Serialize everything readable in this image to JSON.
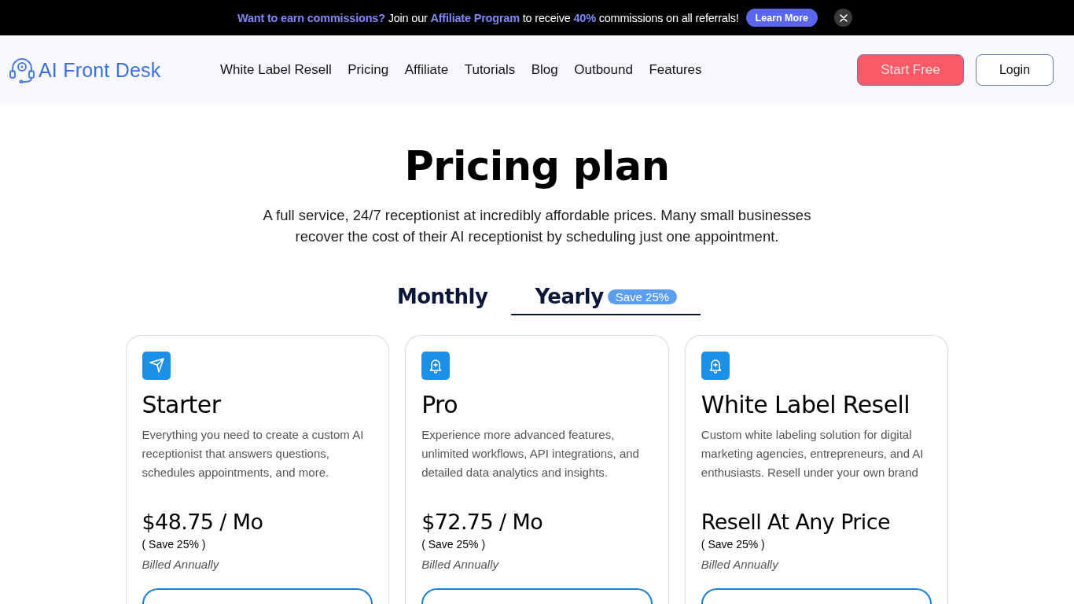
{
  "banner": {
    "message": "**Want to earn commissions?** Join our **Affiliate Program** to receive **40%** commissions on all referrals!",
    "button": "Learn More"
  },
  "header": {
    "logo": "AI Front Desk",
    "nav": [
      "White Label Resell",
      "Pricing",
      "Affiliate",
      "Tutorials",
      "Blog",
      "Outbound",
      "Features"
    ],
    "start_button": "Start Free",
    "login_button": "Login"
  },
  "hero": {
    "title": "Pricing plan",
    "subtitle": "A full service, 24/7 receptionist at incredibly affordable prices. Many small businesses recover the cost of their AI receptionist by scheduling just one appointment."
  },
  "billing_tabs": [
    {
      "label": "Monthly",
      "selected": false
    },
    {
      "label": "Yearly",
      "selected": true,
      "badge": "Save 25%"
    }
  ],
  "plans": [
    {
      "name": "Starter",
      "description": "Everything you need to create a custom AI receptionist that answers questions, schedules appointments, and more.",
      "price": "$48.75 / Mo",
      "savings": "( Save 25% )",
      "billing": "Billed Annually"
    },
    {
      "name": "Pro",
      "description": "Experience more advanced features, unlimited workflows, API integrations, and detailed data analytics and insights.",
      "price": "$72.75 / Mo",
      "savings": "( Save 25% )",
      "billing": "Billed Annually"
    },
    {
      "name": "White Label Resell",
      "description": "Custom white labeling solution for digital marketing agencies, entrepreneurs, and AI enthusiasts. Resell under your own brand",
      "price": "Resell At Any Price",
      "savings": "( Save 25% )",
      "billing": "Billed Annually"
    }
  ]
}
